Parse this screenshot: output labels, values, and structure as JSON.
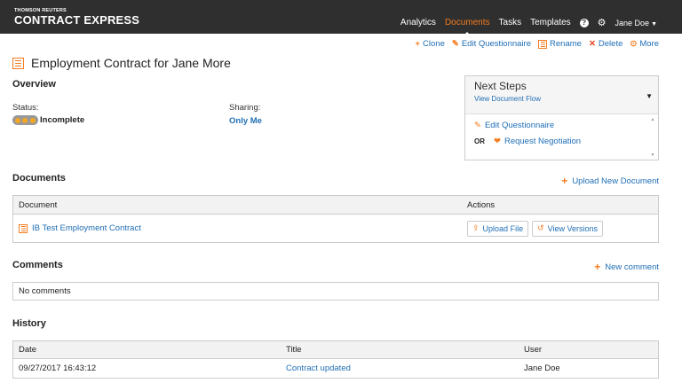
{
  "brand": {
    "top": "THOMSON REUTERS",
    "main": "CONTRACT EXPRESS"
  },
  "nav": {
    "analytics": "Analytics",
    "documents": "Documents",
    "tasks": "Tasks",
    "templates": "Templates",
    "help_icon": "?",
    "user": "Jane Doe"
  },
  "actions": {
    "clone": "Clone",
    "edit": "Edit Questionnaire",
    "rename": "Rename",
    "delete": "Delete",
    "more": "More"
  },
  "title": "Employment Contract for Jane More",
  "overview": {
    "heading": "Overview",
    "status_label": "Status:",
    "status_value": "Incomplete",
    "sharing_label": "Sharing:",
    "sharing_value": "Only Me"
  },
  "next_steps": {
    "title": "Next Steps",
    "flow_link": "View Document Flow",
    "edit": "Edit Questionnaire",
    "or": "OR",
    "negotiate": "Request Negotiation"
  },
  "documents": {
    "heading": "Documents",
    "upload_link": "Upload New Document",
    "col_doc": "Document",
    "col_actions": "Actions",
    "rows": [
      {
        "name": "IB Test Employment Contract",
        "upload": "Upload File",
        "versions": "View Versions"
      }
    ]
  },
  "comments": {
    "heading": "Comments",
    "new_link": "New comment",
    "empty": "No comments"
  },
  "history": {
    "heading": "History",
    "col_date": "Date",
    "col_title": "Title",
    "col_user": "User",
    "rows": [
      {
        "date": "09/27/2017 16:43:12",
        "title": "Contract updated",
        "user": "Jane Doe"
      }
    ]
  },
  "colors": {
    "accent": "#f47b20",
    "link": "#1f6eb5",
    "topbar": "#2f2f2f"
  },
  "icons": [
    "plus-icon",
    "pencil-icon",
    "document-icon",
    "x-icon",
    "chevron-circle-icon",
    "upload-icon",
    "history-icon",
    "handshake-icon",
    "gear-icon",
    "help-icon",
    "caret-down-icon"
  ]
}
